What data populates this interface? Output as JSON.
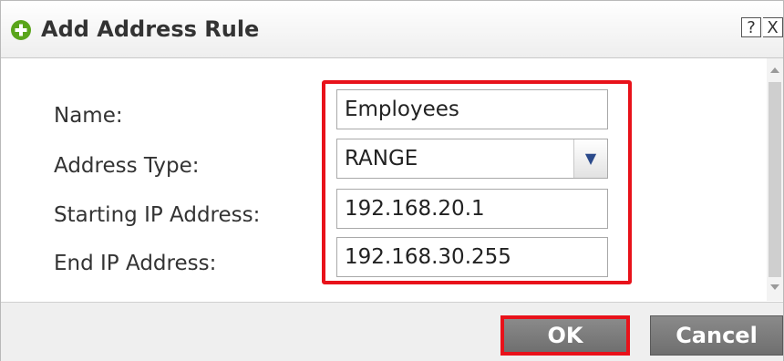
{
  "dialog": {
    "title": "Add Address Rule",
    "help_label": "?",
    "close_label": "X"
  },
  "form": {
    "name_label": "Name:",
    "name_value": "Employees",
    "address_type_label": "Address Type:",
    "address_type_value": "RANGE",
    "start_ip_label": "Starting IP Address:",
    "start_ip_value": "192.168.20.1",
    "end_ip_label": "End IP Address:",
    "end_ip_value": "192.168.30.255"
  },
  "footer": {
    "ok_label": "OK",
    "cancel_label": "Cancel"
  },
  "colors": {
    "highlight": "#e8121a",
    "add_icon": "#5aa51b",
    "button": "#7b7b7b"
  },
  "icons": {
    "add": "plus-circle-icon",
    "select_arrow": "chevron-down-icon"
  }
}
